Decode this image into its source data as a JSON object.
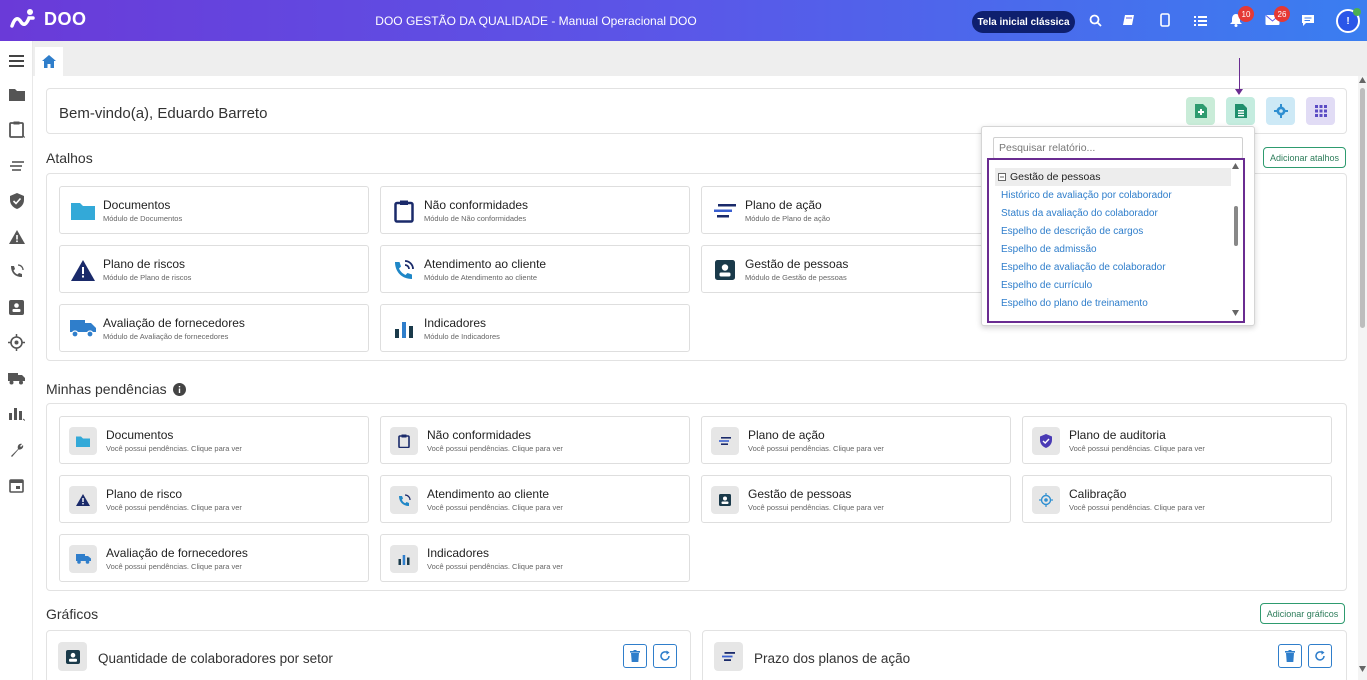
{
  "topbar": {
    "brand": "DOO",
    "title": "DOO GESTÃO DA QUALIDADE - Manual Operacional DOO",
    "classic_button": "Tela inicial clássica",
    "notifications_count": "10",
    "messages_count": "26",
    "avatar_initial": "!"
  },
  "welcome": {
    "text": "Bem-vindo(a), Eduardo Barreto"
  },
  "shortcuts": {
    "title": "Atalhos",
    "add_button": "Adicionar atalhos",
    "items": [
      {
        "title": "Documentos",
        "subtitle": "Módulo de Documentos",
        "icon": "folder-icon"
      },
      {
        "title": "Não conformidades",
        "subtitle": "Módulo de Não conformidades",
        "icon": "clipboard-icon"
      },
      {
        "title": "Plano de ação",
        "subtitle": "Módulo de Plano de ação",
        "icon": "action-plan-icon"
      },
      {
        "title": "Plano de riscos",
        "subtitle": "Módulo de Plano de riscos",
        "icon": "warning-icon"
      },
      {
        "title": "Atendimento ao cliente",
        "subtitle": "Módulo de Atendimento ao cliente",
        "icon": "phone-icon"
      },
      {
        "title": "Gestão de pessoas",
        "subtitle": "Módulo de Gestão de pessoas",
        "icon": "id-card-icon"
      },
      {
        "title": "Avaliação de fornecedores",
        "subtitle": "Módulo de Avaliação de fornecedores",
        "icon": "truck-icon"
      },
      {
        "title": "Indicadores",
        "subtitle": "Módulo de Indicadores",
        "icon": "bar-chart-icon"
      }
    ]
  },
  "pending": {
    "title": "Minhas pendências",
    "items": [
      {
        "title": "Documentos",
        "subtitle": "Você possui pendências. Clique para ver",
        "icon": "folder-icon"
      },
      {
        "title": "Não conformidades",
        "subtitle": "Você possui pendências. Clique para ver",
        "icon": "clipboard-icon"
      },
      {
        "title": "Plano de ação",
        "subtitle": "Você possui pendências. Clique para ver",
        "icon": "action-plan-icon"
      },
      {
        "title": "Plano de auditoria",
        "subtitle": "Você possui pendências. Clique para ver",
        "icon": "shield-icon"
      },
      {
        "title": "Plano de risco",
        "subtitle": "Você possui pendências. Clique para ver",
        "icon": "warning-icon"
      },
      {
        "title": "Atendimento ao cliente",
        "subtitle": "Você possui pendências. Clique para ver",
        "icon": "phone-icon"
      },
      {
        "title": "Gestão de pessoas",
        "subtitle": "Você possui pendências. Clique para ver",
        "icon": "id-card-icon"
      },
      {
        "title": "Calibração",
        "subtitle": "Você possui pendências. Clique para ver",
        "icon": "target-icon"
      },
      {
        "title": "Avaliação de fornecedores",
        "subtitle": "Você possui pendências. Clique para ver",
        "icon": "truck-icon"
      },
      {
        "title": "Indicadores",
        "subtitle": "Você possui pendências. Clique para ver",
        "icon": "bar-chart-icon"
      }
    ]
  },
  "charts": {
    "title": "Gráficos",
    "add_button": "Adicionar gráficos",
    "items": [
      {
        "title": "Quantidade de colaboradores por setor"
      },
      {
        "title": "Prazo dos planos de ação"
      }
    ]
  },
  "report_dropdown": {
    "search_placeholder": "Pesquisar relatório...",
    "group": "Gestão de pessoas",
    "items": [
      "Histórico de avaliação por colaborador",
      "Status da avaliação do colaborador",
      "Espelho de descrição de cargos",
      "Espelho de admissão",
      "Espelho de avaliação de colaborador",
      "Espelho de currículo",
      "Espelho do plano de treinamento"
    ]
  },
  "colors": {
    "accent_blue": "#2f7ecb",
    "highlight_purple": "#6a2c91",
    "green": "#2e9b6f"
  }
}
